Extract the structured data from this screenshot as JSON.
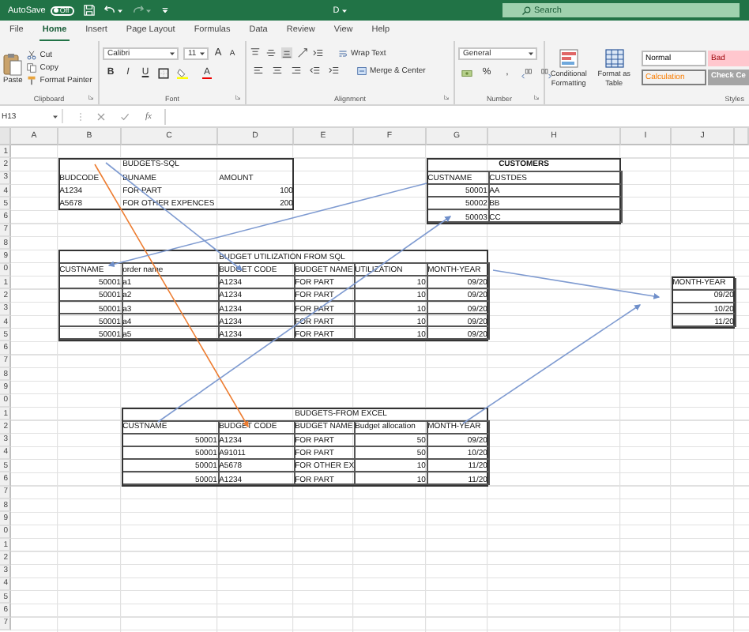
{
  "title_bar": {
    "autosave_label": "AutoSave",
    "autosave_state": "Off",
    "autosave_on": false,
    "document": "D",
    "search_placeholder": "Search"
  },
  "ribbon_tabs": [
    {
      "label": "File",
      "selected": false
    },
    {
      "label": "Home",
      "selected": true
    },
    {
      "label": "Insert",
      "selected": false
    },
    {
      "label": "Page Layout",
      "selected": false
    },
    {
      "label": "Formulas",
      "selected": false
    },
    {
      "label": "Data",
      "selected": false
    },
    {
      "label": "Review",
      "selected": false
    },
    {
      "label": "View",
      "selected": false
    },
    {
      "label": "Help",
      "selected": false
    }
  ],
  "clipboard": {
    "paste": "Paste",
    "cut": "Cut",
    "copy": "Copy",
    "format_painter": "Format Painter",
    "label": "Clipboard"
  },
  "font": {
    "family": "Calibri",
    "size": "11",
    "grow": "A",
    "shrink": "A",
    "bold": "B",
    "italic": "I",
    "underline": "U",
    "color_button": "A",
    "label": "Font"
  },
  "alignment": {
    "wrap": "Wrap Text",
    "merge": "Merge & Center",
    "label": "Alignment"
  },
  "number": {
    "format": "General",
    "percent": "%",
    "comma": ",",
    "label": "Number"
  },
  "styles": {
    "conditional": "Conditional Formatting",
    "format_table": "Format as Table",
    "label": "Styles",
    "cells": [
      {
        "label": "Normal",
        "kind": "normal"
      },
      {
        "label": "Bad",
        "kind": "bad"
      },
      {
        "label": "Calculation",
        "kind": "calculation"
      },
      {
        "label": "Check Ce",
        "kind": "check"
      }
    ]
  },
  "formula_bar": {
    "name_box": "H13",
    "fx": "fx"
  },
  "sheet": {
    "columns": [
      "A",
      "B",
      "C",
      "D",
      "E",
      "F",
      "G",
      "H",
      "I",
      "J"
    ],
    "rows": [
      {
        "label": "1"
      },
      {
        "label": "2",
        "cells": {
          "C": {
            "text": "BUDGETS-SQL",
            "kind": "text"
          },
          "G": {
            "text": "CUSTOMERS",
            "kind": "title"
          }
        }
      },
      {
        "label": "3",
        "cells": {
          "B": {
            "text": "BUDCODE",
            "kind": "text"
          },
          "C": {
            "text": "BUNAME",
            "kind": "text"
          },
          "D": {
            "text": "AMOUNT",
            "kind": "text"
          },
          "G": {
            "text": "CUSTNAME",
            "kind": "text"
          },
          "H": {
            "text": "CUSTDES",
            "kind": "text"
          }
        }
      },
      {
        "label": "4",
        "cells": {
          "B": {
            "text": "A1234",
            "kind": "text"
          },
          "C": {
            "text": "FOR PART",
            "kind": "text"
          },
          "D": {
            "text": "100",
            "kind": "number"
          },
          "G": {
            "text": "50001",
            "kind": "number"
          },
          "H": {
            "text": "AA",
            "kind": "text"
          }
        }
      },
      {
        "label": "5",
        "cells": {
          "B": {
            "text": "A5678",
            "kind": "text"
          },
          "C": {
            "text": "FOR OTHER EXPENCES",
            "kind": "text"
          },
          "D": {
            "text": "200",
            "kind": "number"
          },
          "G": {
            "text": "50002",
            "kind": "number"
          },
          "H": {
            "text": "BB",
            "kind": "text"
          }
        }
      },
      {
        "label": "6",
        "cells": {
          "G": {
            "text": "50003",
            "kind": "number"
          },
          "H": {
            "text": "CC",
            "kind": "text"
          }
        }
      },
      {
        "label": "7"
      },
      {
        "label": "8"
      },
      {
        "label": "9",
        "cells": {
          "D": {
            "text": "BUDGET UTILIZATION FROM SQL",
            "kind": "text"
          }
        }
      },
      {
        "label": "0",
        "cells": {
          "B": {
            "text": "CUSTNAME",
            "kind": "text"
          },
          "C": {
            "text": "order name",
            "kind": "text"
          },
          "D": {
            "text": "BUDGET CODE",
            "kind": "text"
          },
          "E": {
            "text": "BUDGET NAME",
            "kind": "text"
          },
          "F": {
            "text": "UTILIZATION",
            "kind": "text"
          },
          "G": {
            "text": "MONTH-YEAR",
            "kind": "text"
          }
        }
      },
      {
        "label": "1",
        "cells": {
          "B": {
            "text": "50001",
            "kind": "number"
          },
          "C": {
            "text": "a1",
            "kind": "text"
          },
          "D": {
            "text": "A1234",
            "kind": "text"
          },
          "E": {
            "text": "FOR PART",
            "kind": "text"
          },
          "F": {
            "text": "10",
            "kind": "number"
          },
          "G": {
            "text": "09/20",
            "kind": "number"
          },
          "J": {
            "text": "MONTH-YEAR",
            "kind": "text"
          }
        }
      },
      {
        "label": "2",
        "cells": {
          "B": {
            "text": "50001",
            "kind": "number"
          },
          "C": {
            "text": "a2",
            "kind": "text"
          },
          "D": {
            "text": "A1234",
            "kind": "text"
          },
          "E": {
            "text": "FOR PART",
            "kind": "text"
          },
          "F": {
            "text": "10",
            "kind": "number"
          },
          "G": {
            "text": "09/20",
            "kind": "number"
          },
          "J": {
            "text": "09/20",
            "kind": "number"
          }
        }
      },
      {
        "label": "3",
        "cells": {
          "B": {
            "text": "50001",
            "kind": "number"
          },
          "C": {
            "text": "a3",
            "kind": "text"
          },
          "D": {
            "text": "A1234",
            "kind": "text"
          },
          "E": {
            "text": "FOR PART",
            "kind": "text"
          },
          "F": {
            "text": "10",
            "kind": "number"
          },
          "G": {
            "text": "09/20",
            "kind": "number"
          },
          "J": {
            "text": "10/20",
            "kind": "number"
          }
        }
      },
      {
        "label": "4",
        "cells": {
          "B": {
            "text": "50001",
            "kind": "number"
          },
          "C": {
            "text": "a4",
            "kind": "text"
          },
          "D": {
            "text": "A1234",
            "kind": "text"
          },
          "E": {
            "text": "FOR PART",
            "kind": "text"
          },
          "F": {
            "text": "10",
            "kind": "number"
          },
          "G": {
            "text": "09/20",
            "kind": "number"
          },
          "J": {
            "text": "11/20",
            "kind": "number"
          }
        }
      },
      {
        "label": "5",
        "cells": {
          "B": {
            "text": "50001",
            "kind": "number"
          },
          "C": {
            "text": "a5",
            "kind": "text"
          },
          "D": {
            "text": "A1234",
            "kind": "text"
          },
          "E": {
            "text": "FOR PART",
            "kind": "text"
          },
          "F": {
            "text": "10",
            "kind": "number"
          },
          "G": {
            "text": "09/20",
            "kind": "number"
          }
        }
      },
      {
        "label": "6"
      },
      {
        "label": "7"
      },
      {
        "label": "8"
      },
      {
        "label": "9"
      },
      {
        "label": "0"
      },
      {
        "label": "1",
        "cells": {
          "E": {
            "text": "BUDGETS-FROM EXCEL",
            "kind": "text"
          }
        }
      },
      {
        "label": "2",
        "cells": {
          "C": {
            "text": "CUSTNAME",
            "kind": "text"
          },
          "D": {
            "text": "BUDGET CODE",
            "kind": "text"
          },
          "E": {
            "text": "BUDGET NAME",
            "kind": "text"
          },
          "F": {
            "text": "Budget allocation",
            "kind": "text"
          },
          "G": {
            "text": "MONTH-YEAR",
            "kind": "text"
          }
        }
      },
      {
        "label": "3",
        "cells": {
          "C": {
            "text": "50001",
            "kind": "number"
          },
          "D": {
            "text": "A1234",
            "kind": "text"
          },
          "E": {
            "text": "FOR PART",
            "kind": "text"
          },
          "F": {
            "text": "50",
            "kind": "number"
          },
          "G": {
            "text": "09/20",
            "kind": "number"
          }
        }
      },
      {
        "label": "4",
        "cells": {
          "C": {
            "text": "50001",
            "kind": "number"
          },
          "D": {
            "text": "A91011",
            "kind": "text"
          },
          "E": {
            "text": "FOR PART",
            "kind": "text"
          },
          "F": {
            "text": "50",
            "kind": "number"
          },
          "G": {
            "text": "10/20",
            "kind": "number"
          }
        }
      },
      {
        "label": "5",
        "cells": {
          "C": {
            "text": "50001",
            "kind": "number"
          },
          "D": {
            "text": "A5678",
            "kind": "text"
          },
          "E": {
            "text": "FOR OTHER EX",
            "kind": "text"
          },
          "F": {
            "text": "10",
            "kind": "number"
          },
          "G": {
            "text": "11/20",
            "kind": "number"
          }
        }
      },
      {
        "label": "6",
        "cells": {
          "C": {
            "text": "50001",
            "kind": "number"
          },
          "D": {
            "text": "A1234",
            "kind": "text"
          },
          "E": {
            "text": "FOR PART",
            "kind": "text"
          },
          "F": {
            "text": "10",
            "kind": "number"
          },
          "G": {
            "text": "11/20",
            "kind": "number"
          }
        }
      },
      {
        "label": "7"
      },
      {
        "label": "8"
      },
      {
        "label": "9"
      },
      {
        "label": "0"
      },
      {
        "label": "1"
      },
      {
        "label": "2"
      },
      {
        "label": "3"
      },
      {
        "label": "4"
      },
      {
        "label": "5"
      },
      {
        "label": "6"
      },
      {
        "label": "7"
      }
    ]
  }
}
